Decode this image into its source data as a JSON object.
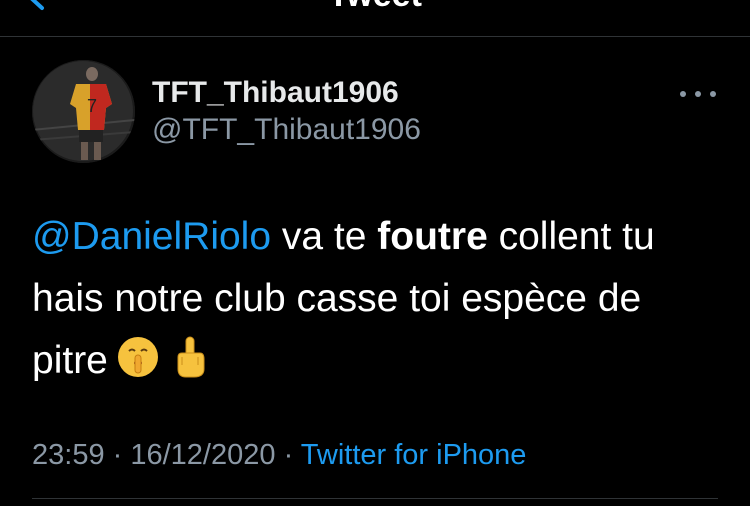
{
  "nav": {
    "title": "Tweet",
    "back_icon": "chevron-left-icon"
  },
  "tweet": {
    "author": {
      "display_name": "TFT_Thibaut1906",
      "handle": "@TFT_Thibaut1906",
      "avatar_icon": "avatar"
    },
    "body": {
      "mention": "@DanielRiolo",
      "text_1": " va te ",
      "bold_word": "foutre",
      "text_2": " collent tu hais notre club casse toi espèce de pitre",
      "emojis": [
        "shushing-face-icon",
        "middle-finger-icon"
      ]
    },
    "time": "23:59",
    "separator_1": " · ",
    "date": "16/12/2020",
    "separator_2": " · ",
    "source": "Twitter for iPhone"
  },
  "colors": {
    "background": "#000000",
    "link": "#1d9bf0",
    "secondary_text": "#8b98a5",
    "divider": "#2f3336"
  }
}
